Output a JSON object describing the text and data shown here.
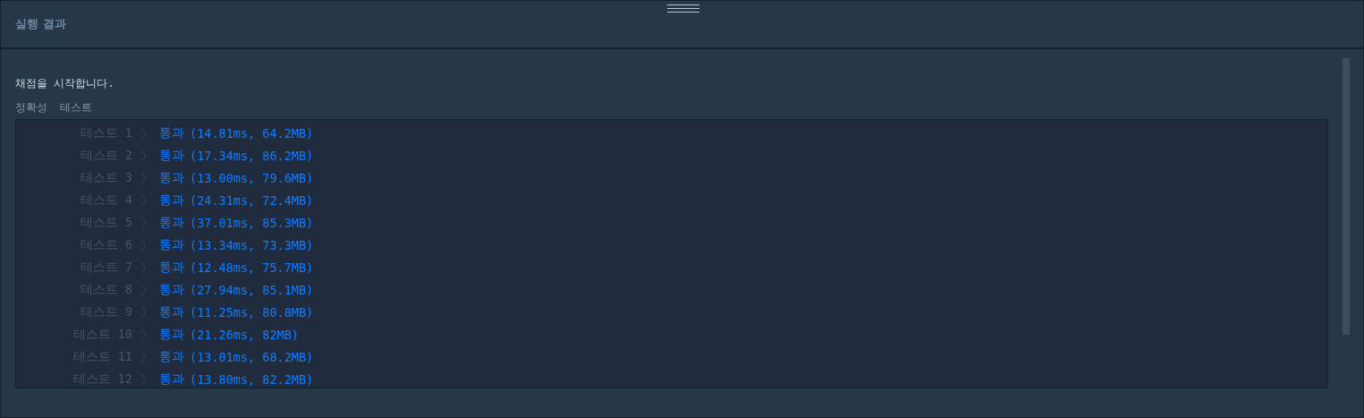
{
  "panel": {
    "title": "실행 결과"
  },
  "message": "채점을 시작합니다.",
  "section_labels": [
    "정확성",
    "테스트"
  ],
  "results": [
    {
      "label": "테스트 1",
      "status": "통과",
      "detail": "(14.81ms, 64.2MB)"
    },
    {
      "label": "테스트 2",
      "status": "통과",
      "detail": "(17.34ms, 86.2MB)"
    },
    {
      "label": "테스트 3",
      "status": "통과",
      "detail": "(13.00ms, 79.6MB)"
    },
    {
      "label": "테스트 4",
      "status": "통과",
      "detail": "(24.31ms, 72.4MB)"
    },
    {
      "label": "테스트 5",
      "status": "통과",
      "detail": "(37.01ms, 85.3MB)"
    },
    {
      "label": "테스트 6",
      "status": "통과",
      "detail": "(13.34ms, 73.3MB)"
    },
    {
      "label": "테스트 7",
      "status": "통과",
      "detail": "(12.48ms, 75.7MB)"
    },
    {
      "label": "테스트 8",
      "status": "통과",
      "detail": "(27.94ms, 85.1MB)"
    },
    {
      "label": "테스트 9",
      "status": "통과",
      "detail": "(11.25ms, 80.8MB)"
    },
    {
      "label": "테스트 10",
      "status": "통과",
      "detail": "(21.26ms, 82MB)"
    },
    {
      "label": "테스트 11",
      "status": "통과",
      "detail": "(13.01ms, 68.2MB)"
    },
    {
      "label": "테스트 12",
      "status": "통과",
      "detail": "(13.80ms, 82.2MB)"
    }
  ]
}
